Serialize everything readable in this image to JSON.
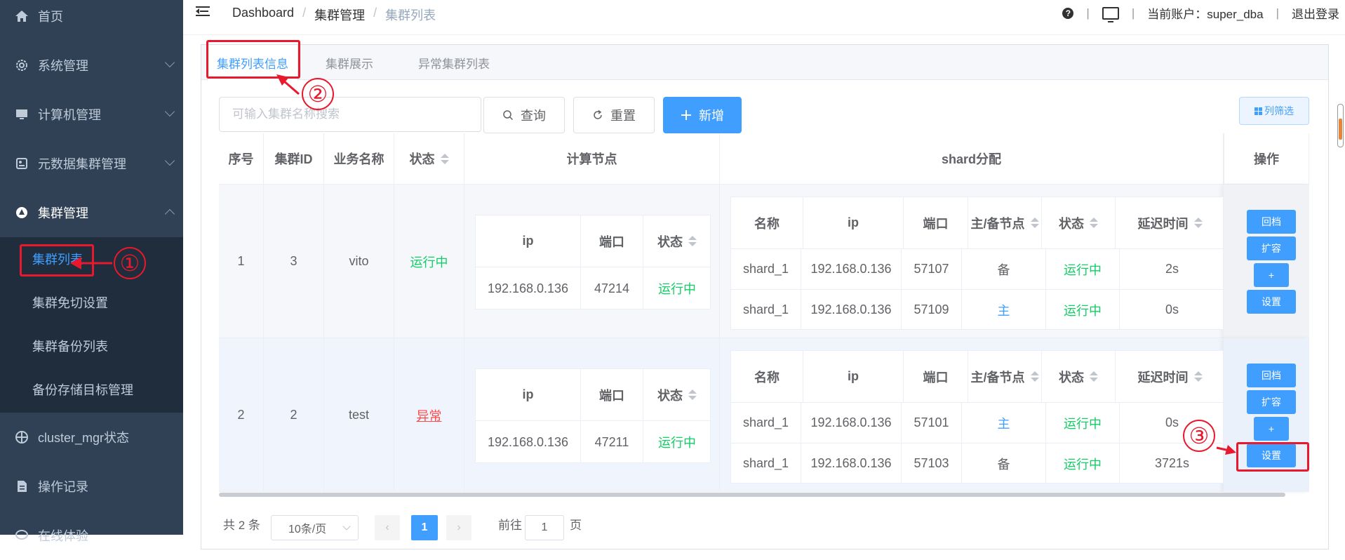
{
  "sidebar": {
    "items": [
      {
        "label": "首页",
        "icon": "home-icon"
      },
      {
        "label": "系统管理",
        "icon": "gear-icon"
      },
      {
        "label": "计算机管理",
        "icon": "monitor-icon"
      },
      {
        "label": "元数据集群管理",
        "icon": "database-icon"
      },
      {
        "label": "集群管理",
        "icon": "cluster-icon"
      },
      {
        "label": "cluster_mgr状态",
        "icon": "target-icon"
      },
      {
        "label": "操作记录",
        "icon": "document-icon"
      },
      {
        "label": "在线体验",
        "icon": "chat-icon"
      }
    ],
    "sub_items": [
      {
        "label": "集群列表"
      },
      {
        "label": "集群免切设置"
      },
      {
        "label": "集群备份列表"
      },
      {
        "label": "备份存储目标管理"
      }
    ]
  },
  "topbar": {
    "breadcrumb": [
      "Dashboard",
      "集群管理",
      "集群列表"
    ],
    "account_label": "当前账户：super_dba",
    "logout": "退出登录"
  },
  "tabs": [
    "集群列表信息",
    "集群展示",
    "异常集群列表"
  ],
  "toolbar": {
    "search_placeholder": "可输入集群名称搜索",
    "query": "查询",
    "reset": "重置",
    "add": "新增",
    "columns": "列筛选"
  },
  "table": {
    "headers": [
      "序号",
      "集群ID",
      "业务名称",
      "状态",
      "计算节点",
      "shard分配",
      "操作"
    ],
    "comp_headers": [
      "ip",
      "端口",
      "状态"
    ],
    "shard_headers": [
      "名称",
      "ip",
      "端口",
      "主/备节点",
      "状态",
      "延迟时间"
    ],
    "rows": [
      {
        "index": "1",
        "id": "3",
        "name": "vito",
        "status": "运行中",
        "comp": {
          "ip": "192.168.0.136",
          "port": "47214",
          "status": "运行中"
        },
        "shards": [
          {
            "name": "shard_1",
            "ip": "192.168.0.136",
            "port": "57107",
            "role": "备",
            "status": "运行中",
            "delay": "2s"
          },
          {
            "name": "shard_1",
            "ip": "192.168.0.136",
            "port": "57109",
            "role": "主",
            "status": "运行中",
            "delay": "0s"
          }
        ]
      },
      {
        "index": "2",
        "id": "2",
        "name": "test",
        "status": "异常",
        "comp": {
          "ip": "192.168.0.136",
          "port": "47211",
          "status": "运行中"
        },
        "shards": [
          {
            "name": "shard_1",
            "ip": "192.168.0.136",
            "port": "57101",
            "role": "主",
            "status": "运行中",
            "delay": "0s"
          },
          {
            "name": "shard_1",
            "ip": "192.168.0.136",
            "port": "57103",
            "role": "备",
            "status": "运行中",
            "delay": "3721s"
          }
        ]
      }
    ],
    "ops": [
      "回档",
      "扩容",
      "+",
      "设置"
    ]
  },
  "pagination": {
    "total": "共 2 条",
    "page_size": "10条/页",
    "current": "1",
    "goto_prefix": "前往",
    "goto_value": "1",
    "goto_suffix": "页"
  },
  "annotations": [
    "①",
    "②",
    "③"
  ],
  "colors": {
    "accent": "#409eff",
    "running": "#13ce66",
    "error": "#ff4949",
    "sidebar": "#304156",
    "annotation": "#e8192c"
  }
}
